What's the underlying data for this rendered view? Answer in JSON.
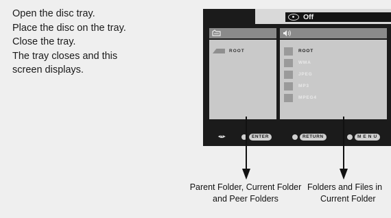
{
  "instructions": [
    "Open the disc tray.",
    "Place the disc on the tray.",
    "Close the tray.",
    "The tray closes and this",
    "screen displays."
  ],
  "screen": {
    "status": "Off",
    "left_pane": {
      "root": "ROOT"
    },
    "right_pane": {
      "items": [
        "ROOT",
        "WMA",
        "JPEG",
        "MP3",
        "MPEG4"
      ],
      "selected": "ROOT"
    },
    "controls": {
      "enter": "ENTER",
      "return": "RETURN",
      "menu": "M E N U"
    }
  },
  "captions": {
    "left": [
      "Parent Folder, Current Folder",
      "and Peer Folders"
    ],
    "right": [
      "Folders and Files in",
      "Current Folder"
    ]
  },
  "colors": {
    "background": "#efefef",
    "screen": "#1b1b1b",
    "pane": "#c9c9c9",
    "pane_header": "#8a8a8a"
  }
}
